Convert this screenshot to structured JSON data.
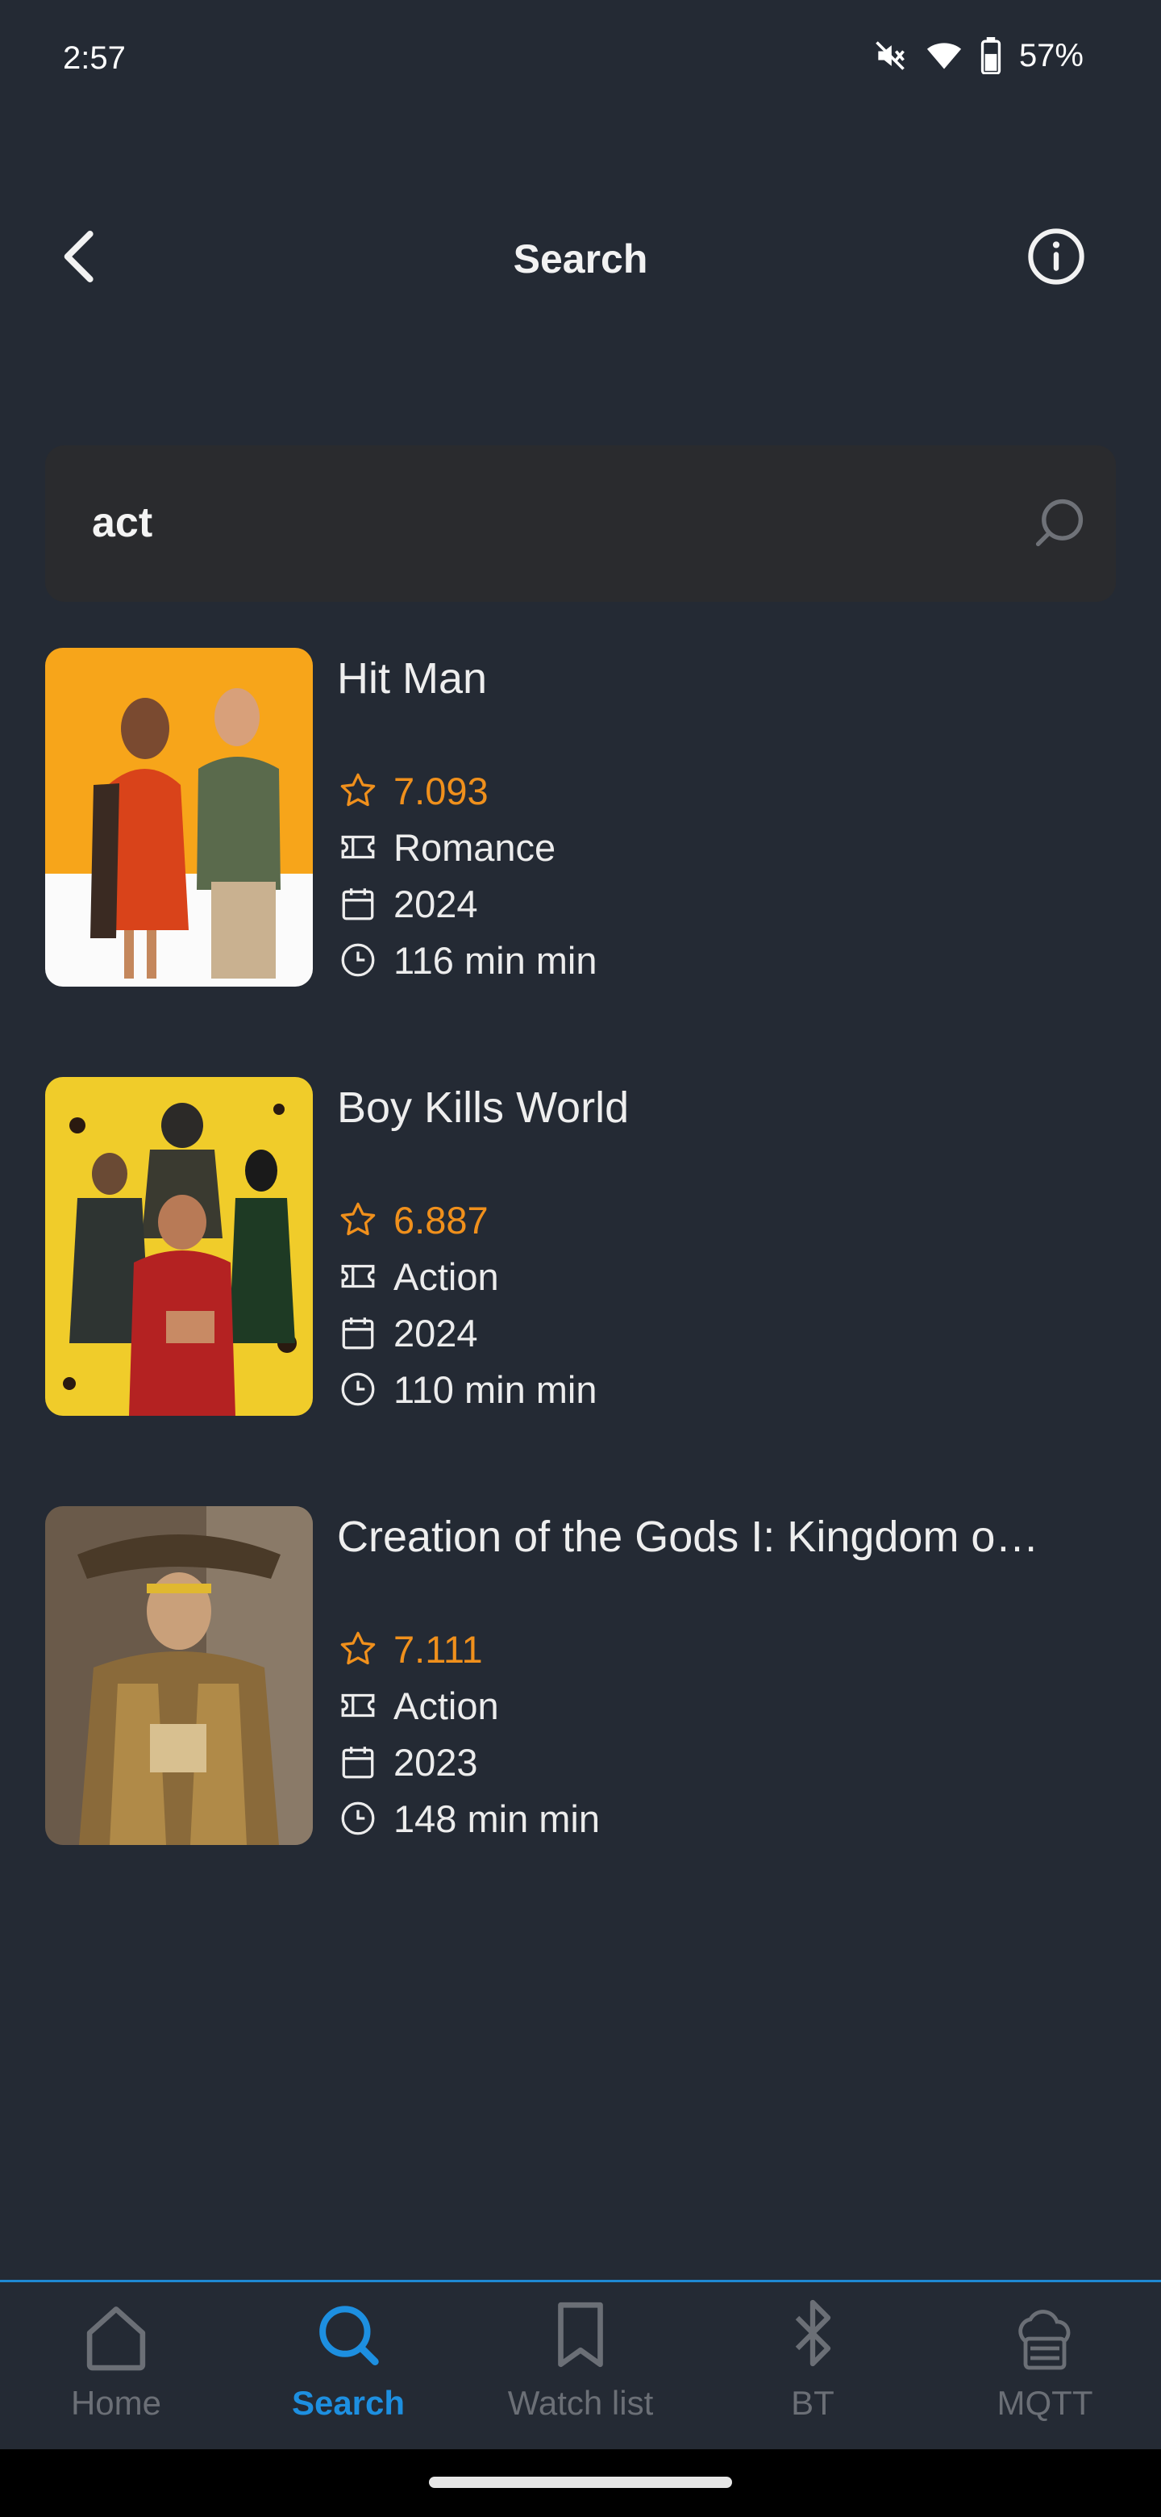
{
  "status_bar": {
    "time": "2:57",
    "battery": "57%",
    "icons": [
      "mute-icon",
      "wifi-icon",
      "battery-icon"
    ]
  },
  "app_bar": {
    "title": "Search",
    "back_icon": "chevron-left-icon",
    "info_icon": "info-icon"
  },
  "search": {
    "value": "act",
    "icon": "search-icon"
  },
  "results": [
    {
      "title": "Hit Man",
      "rating": "7.093",
      "genre": "Romance",
      "year": "2024",
      "runtime": "116 min min",
      "poster_icon": "poster-image"
    },
    {
      "title": "Boy Kills World",
      "rating": "6.887",
      "genre": "Action",
      "year": "2024",
      "runtime": "110 min min",
      "poster_icon": "poster-image"
    },
    {
      "title": "Creation of the Gods I: Kingdom o…",
      "rating": "7.111",
      "genre": "Action",
      "year": "2023",
      "runtime": "148 min min",
      "poster_icon": "poster-image"
    }
  ],
  "bottom_nav": {
    "items": [
      {
        "label": "Home",
        "icon": "home-icon",
        "active": false
      },
      {
        "label": "Search",
        "icon": "search-icon",
        "active": true
      },
      {
        "label": "Watch list",
        "icon": "bookmark-icon",
        "active": false
      },
      {
        "label": "BT",
        "icon": "bluetooth-icon",
        "active": false
      },
      {
        "label": "MQTT",
        "icon": "mqtt-icon",
        "active": false
      }
    ]
  },
  "colors": {
    "background": "#242a34",
    "accent": "#1d8fe0",
    "rating": "#f0901c",
    "search_field": "#2a2b2e"
  }
}
